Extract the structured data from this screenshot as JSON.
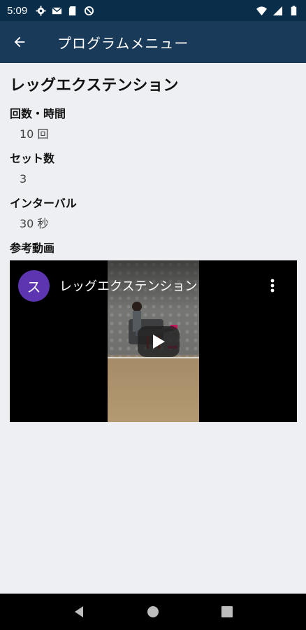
{
  "status_bar": {
    "time": "5:09",
    "left_icons": [
      "gear-icon",
      "mail-icon",
      "sd-card-icon",
      "blocked-icon"
    ],
    "right_icons": [
      "wifi-icon",
      "signal-icon",
      "battery-icon"
    ]
  },
  "app_bar": {
    "back_icon": "arrow-left-icon",
    "title": "プログラムメニュー"
  },
  "program": {
    "title": "レッグエクステンション",
    "fields": [
      {
        "label": "回数・時間",
        "value": "10 回"
      },
      {
        "label": "セット数",
        "value": "3"
      },
      {
        "label": "インターバル",
        "value": "30 秒"
      }
    ],
    "video_label": "参考動画"
  },
  "video": {
    "channel_initial": "ス",
    "title": "レッグエクステンション",
    "more_icon": "more-vertical-icon",
    "play_icon": "play-icon",
    "colors": {
      "avatar": "#5e35b1"
    }
  },
  "nav_bar": {
    "buttons": [
      "back-triangle-icon",
      "home-circle-icon",
      "recents-square-icon"
    ]
  },
  "colors": {
    "app_bar": "#1a3a5a",
    "status_bar": "#0a2e4a",
    "background": "#eeeff2"
  }
}
